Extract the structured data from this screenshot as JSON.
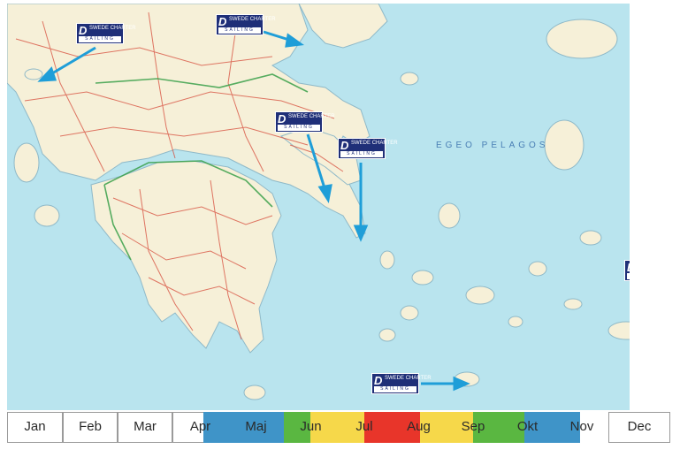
{
  "map": {
    "sea_label": "EGEO PELAGOS",
    "colors": {
      "sea": "#b9e4ee",
      "land": "#f6f0d8",
      "coast_land": "#f0e6c4",
      "roads": "#d64b3a",
      "border_roads": "#3aa04a",
      "arrow": "#1f9ed8"
    },
    "marker": {
      "logo": "D",
      "line1": "SWEDE",
      "line2": "CHARTER",
      "line3": "SAILING"
    }
  },
  "timeline": {
    "months": [
      "Jan",
      "Feb",
      "Mar",
      "Apr",
      "Maj",
      "Jun",
      "Jul",
      "Aug",
      "Sep",
      "Okt",
      "Nov",
      "Dec"
    ],
    "season_colors": {
      "low": "#3f94c8",
      "mid": "#5ab741",
      "high": "#f6d84a",
      "peak": "#e8352a"
    }
  }
}
